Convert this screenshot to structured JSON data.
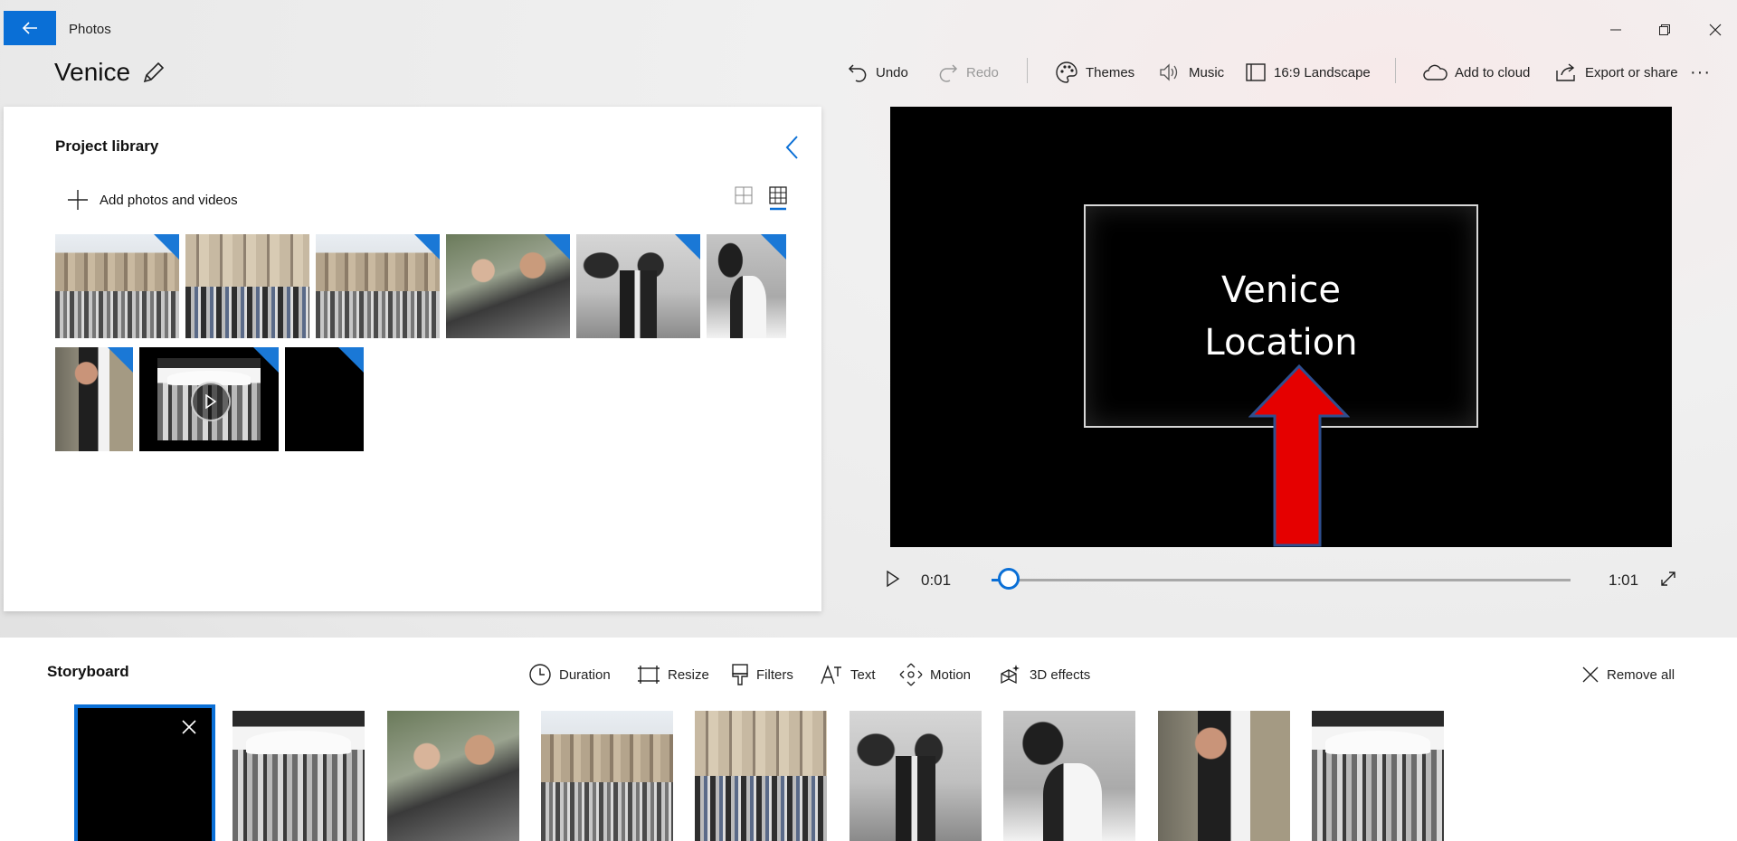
{
  "app": {
    "title": "Photos"
  },
  "project": {
    "title": "Venice"
  },
  "toolbar": {
    "undo": "Undo",
    "redo": "Redo",
    "themes": "Themes",
    "music": "Music",
    "aspect": "16:9 Landscape",
    "cloud": "Add to cloud",
    "export": "Export or share",
    "more": "···"
  },
  "library": {
    "title": "Project library",
    "add_label": "Add photos and videos",
    "items": [
      {
        "kind": "photo",
        "scene": "basilica",
        "added": true
      },
      {
        "kind": "photo",
        "scene": "basilica",
        "added": false
      },
      {
        "kind": "photo",
        "scene": "basilica",
        "added": true
      },
      {
        "kind": "photo",
        "scene": "crowd",
        "added": true
      },
      {
        "kind": "photo",
        "scene": "arcade",
        "added": true
      },
      {
        "kind": "photo",
        "scene": "arcade",
        "added": true
      },
      {
        "kind": "photo",
        "scene": "man",
        "added": true
      },
      {
        "kind": "video",
        "scene": "cafe",
        "added": true
      },
      {
        "kind": "title-card",
        "scene": "black",
        "added": true
      }
    ]
  },
  "preview": {
    "card_line1": "Venice",
    "card_line2": "Location",
    "time_current": "0:01",
    "time_total": "1:01",
    "progress": 0.03
  },
  "storyboard": {
    "title": "Storyboard",
    "tools": {
      "duration": "Duration",
      "resize": "Resize",
      "filters": "Filters",
      "text": "Text",
      "motion": "Motion",
      "effects3d": "3D effects",
      "remove_all": "Remove all"
    },
    "clips": [
      "title-card",
      "cafe",
      "crowd",
      "basilica",
      "basilica",
      "arcade",
      "arcade",
      "man",
      "cafe"
    ]
  },
  "colors": {
    "accent": "#0a6fd6",
    "arrow": "#e50000",
    "arrow_outline": "#2f4f8f"
  }
}
